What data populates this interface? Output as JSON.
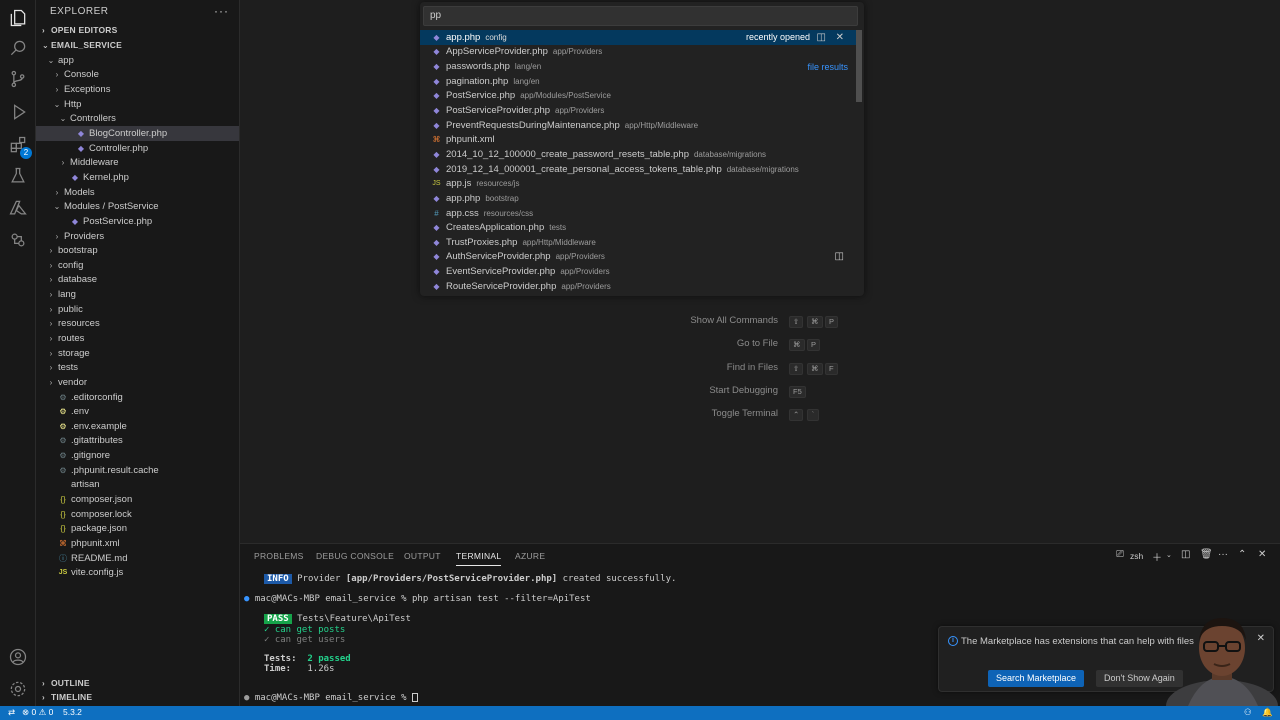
{
  "explorer": {
    "title": "EXPLORER",
    "more": "···",
    "open_editors": "OPEN EDITORS",
    "project": "EMAIL_SERVICE",
    "outline": "OUTLINE",
    "timeline": "TIMELINE"
  },
  "activity_bar": {
    "extensions_badge": "2",
    "icons": [
      "files-icon",
      "search-icon",
      "source-control-icon",
      "run-debug-icon",
      "extensions-icon",
      "testing-icon",
      "azure-icon",
      "remote-explorer-icon",
      "account-icon",
      "settings-gear-icon"
    ]
  },
  "tree": [
    {
      "label": "app",
      "depth": 0,
      "chevron": "open",
      "icon": "folder"
    },
    {
      "label": "Console",
      "depth": 1,
      "chevron": "closed",
      "icon": "folder"
    },
    {
      "label": "Exceptions",
      "depth": 1,
      "chevron": "closed",
      "icon": "folder"
    },
    {
      "label": "Http",
      "depth": 1,
      "chevron": "open",
      "icon": "folder"
    },
    {
      "label": "Controllers",
      "depth": 2,
      "chevron": "open",
      "icon": "folder"
    },
    {
      "label": "BlogController.php",
      "depth": 3,
      "chevron": "none",
      "icon": "php",
      "selected": true
    },
    {
      "label": "Controller.php",
      "depth": 3,
      "chevron": "none",
      "icon": "php"
    },
    {
      "label": "Middleware",
      "depth": 2,
      "chevron": "closed",
      "icon": "folder"
    },
    {
      "label": "Kernel.php",
      "depth": 2,
      "chevron": "none",
      "icon": "php"
    },
    {
      "label": "Models",
      "depth": 1,
      "chevron": "closed",
      "icon": "folder"
    },
    {
      "label": "Modules / PostService",
      "depth": 1,
      "chevron": "open",
      "icon": "folder"
    },
    {
      "label": "PostService.php",
      "depth": 2,
      "chevron": "none",
      "icon": "php"
    },
    {
      "label": "Providers",
      "depth": 1,
      "chevron": "closed",
      "icon": "folder"
    },
    {
      "label": "bootstrap",
      "depth": 0,
      "chevron": "closed",
      "icon": "folder"
    },
    {
      "label": "config",
      "depth": 0,
      "chevron": "closed",
      "icon": "folder"
    },
    {
      "label": "database",
      "depth": 0,
      "chevron": "closed",
      "icon": "folder"
    },
    {
      "label": "lang",
      "depth": 0,
      "chevron": "closed",
      "icon": "folder"
    },
    {
      "label": "public",
      "depth": 0,
      "chevron": "closed",
      "icon": "folder"
    },
    {
      "label": "resources",
      "depth": 0,
      "chevron": "closed",
      "icon": "folder"
    },
    {
      "label": "routes",
      "depth": 0,
      "chevron": "closed",
      "icon": "folder"
    },
    {
      "label": "storage",
      "depth": 0,
      "chevron": "closed",
      "icon": "folder"
    },
    {
      "label": "tests",
      "depth": 0,
      "chevron": "closed",
      "icon": "folder"
    },
    {
      "label": "vendor",
      "depth": 0,
      "chevron": "closed",
      "icon": "folder"
    },
    {
      "label": ".editorconfig",
      "depth": 0,
      "chevron": "none",
      "icon": "gear"
    },
    {
      "label": ".env",
      "depth": 0,
      "chevron": "none",
      "icon": "env"
    },
    {
      "label": ".env.example",
      "depth": 0,
      "chevron": "none",
      "icon": "env"
    },
    {
      "label": ".gitattributes",
      "depth": 0,
      "chevron": "none",
      "icon": "gear"
    },
    {
      "label": ".gitignore",
      "depth": 0,
      "chevron": "none",
      "icon": "gear"
    },
    {
      "label": ".phpunit.result.cache",
      "depth": 0,
      "chevron": "none",
      "icon": "gear"
    },
    {
      "label": "artisan",
      "depth": 0,
      "chevron": "none",
      "icon": "plain"
    },
    {
      "label": "composer.json",
      "depth": 0,
      "chevron": "none",
      "icon": "json"
    },
    {
      "label": "composer.lock",
      "depth": 0,
      "chevron": "none",
      "icon": "json"
    },
    {
      "label": "package.json",
      "depth": 0,
      "chevron": "none",
      "icon": "json"
    },
    {
      "label": "phpunit.xml",
      "depth": 0,
      "chevron": "none",
      "icon": "xml"
    },
    {
      "label": "README.md",
      "depth": 0,
      "chevron": "none",
      "icon": "md"
    },
    {
      "label": "vite.config.js",
      "depth": 0,
      "chevron": "none",
      "icon": "js"
    }
  ],
  "quick_open": {
    "query": "pp",
    "recently_opened": "recently opened",
    "file_results": "file results",
    "items": [
      {
        "name": "app.php",
        "desc": "config",
        "icon": "php",
        "selected": true
      },
      {
        "name": "AppServiceProvider.php",
        "desc": "app/Providers",
        "icon": "php"
      },
      {
        "name": "passwords.php",
        "desc": "lang/en",
        "icon": "php",
        "group": "file results"
      },
      {
        "name": "pagination.php",
        "desc": "lang/en",
        "icon": "php"
      },
      {
        "name": "PostService.php",
        "desc": "app/Modules/PostService",
        "icon": "php"
      },
      {
        "name": "PostServiceProvider.php",
        "desc": "app/Providers",
        "icon": "php"
      },
      {
        "name": "PreventRequestsDuringMaintenance.php",
        "desc": "app/Http/Middleware",
        "icon": "php"
      },
      {
        "name": "phpunit.xml",
        "desc": "",
        "icon": "xml"
      },
      {
        "name": "2014_10_12_100000_create_password_resets_table.php",
        "desc": "database/migrations",
        "icon": "php"
      },
      {
        "name": "2019_12_14_000001_create_personal_access_tokens_table.php",
        "desc": "database/migrations",
        "icon": "php"
      },
      {
        "name": "app.js",
        "desc": "resources/js",
        "icon": "js"
      },
      {
        "name": "app.php",
        "desc": "bootstrap",
        "icon": "php"
      },
      {
        "name": "app.css",
        "desc": "resources/css",
        "icon": "css"
      },
      {
        "name": "CreatesApplication.php",
        "desc": "tests",
        "icon": "php"
      },
      {
        "name": "TrustProxies.php",
        "desc": "app/Http/Middleware",
        "icon": "php"
      },
      {
        "name": "AuthServiceProvider.php",
        "desc": "app/Providers",
        "icon": "php",
        "hover": true
      },
      {
        "name": "EventServiceProvider.php",
        "desc": "app/Providers",
        "icon": "php"
      },
      {
        "name": "RouteServiceProvider.php",
        "desc": "app/Providers",
        "icon": "php"
      }
    ]
  },
  "welcome_shortcuts": [
    {
      "label": "Show All Commands",
      "keys": [
        "⇧",
        "⌘",
        "P"
      ]
    },
    {
      "label": "Go to File",
      "keys": [
        "⌘",
        "P"
      ]
    },
    {
      "label": "Find in Files",
      "keys": [
        "⇧",
        "⌘",
        "F"
      ]
    },
    {
      "label": "Start Debugging",
      "keys": [
        "F5"
      ]
    },
    {
      "label": "Toggle Terminal",
      "keys": [
        "⌃",
        "`"
      ]
    }
  ],
  "panel": {
    "tabs": [
      "PROBLEMS",
      "DEBUG CONSOLE",
      "OUTPUT",
      "TERMINAL",
      "AZURE"
    ],
    "active_tab": "TERMINAL",
    "shell": "zsh",
    "terminal": {
      "info_tag": "INFO",
      "info_text_a": " Provider ",
      "info_text_b": "[app/Providers/PostServiceProvider.php]",
      "info_text_c": " created successfully.",
      "prompt1": "mac@MACs-MBP email_service % php artisan test --filter=ApiTest",
      "pass_tag": "PASS",
      "pass_text": " Tests\\Feature\\ApiTest",
      "test1": "✓ can get posts",
      "test2": "✓ can get users",
      "tests_label": "Tests:",
      "tests_value": "2 passed",
      "time_label": "Time:",
      "time_value": "1.26s",
      "prompt2": "mac@MACs-MBP email_service % "
    }
  },
  "notification": {
    "message": "The Marketplace has extensions that can help with files",
    "primary_button": "Search Marketplace",
    "secondary_button": "Don't Show Again"
  },
  "status_bar": {
    "errors": "0",
    "warnings": "0",
    "version": "5.3.2"
  },
  "colors": {
    "accent": "#0078d4",
    "statusbar": "#0e6fc0",
    "selection": "#04395e"
  }
}
